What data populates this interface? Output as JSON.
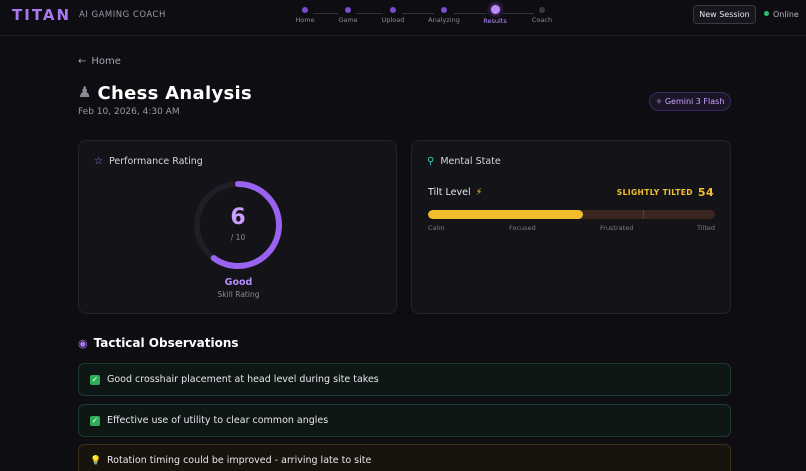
{
  "app": {
    "brand": "TITAN",
    "subtitle": "AI GAMING COACH"
  },
  "steps": [
    {
      "label": "Home",
      "state": "done"
    },
    {
      "label": "Game",
      "state": "done"
    },
    {
      "label": "Upload",
      "state": "done"
    },
    {
      "label": "Analyzing",
      "state": "done"
    },
    {
      "label": "Results",
      "state": "active"
    },
    {
      "label": "Coach",
      "state": "pending"
    }
  ],
  "header": {
    "new_session_label": "New Session",
    "status_label": "Online"
  },
  "page": {
    "back_label": "Home",
    "title": "Chess Analysis",
    "date": "Feb 10, 2026, 4:30 AM",
    "model_badge": "Gemini 3 Flash"
  },
  "performance": {
    "title": "Performance Rating",
    "score": "6",
    "score_max": "/ 10",
    "score_fraction": 0.6,
    "grade": "Good",
    "grade_sub": "Skill Rating"
  },
  "mental": {
    "title": "Mental State",
    "tilt_label": "Tilt Level",
    "status": "SLIGHTLY TILTED",
    "tilt_value": "54",
    "tilt_fraction": 0.54,
    "scale": [
      "Calm",
      "Focused",
      "Frustrated",
      "Tilted"
    ]
  },
  "tactical": {
    "title": "Tactical Observations",
    "items": [
      {
        "type": "good",
        "text": "Good crosshair placement at head level during site takes"
      },
      {
        "type": "good",
        "text": "Effective use of utility to clear common angles"
      },
      {
        "type": "tip",
        "text": "Rotation timing could be improved - arriving late to site"
      }
    ]
  },
  "colors": {
    "accent": "#a878f0",
    "tilt": "#f0be2c",
    "success": "#2fae5a",
    "online": "#2fbf74"
  },
  "icons": {
    "back": "arrow-left-icon",
    "title": "chess-pawn-icon",
    "badge": "sparkle-icon",
    "performance": "star-icon",
    "mental": "lightbulb-icon",
    "tilt": "lightning-icon",
    "tactical": "eye-icon",
    "good": "check-icon",
    "tip": "bulb-icon"
  }
}
